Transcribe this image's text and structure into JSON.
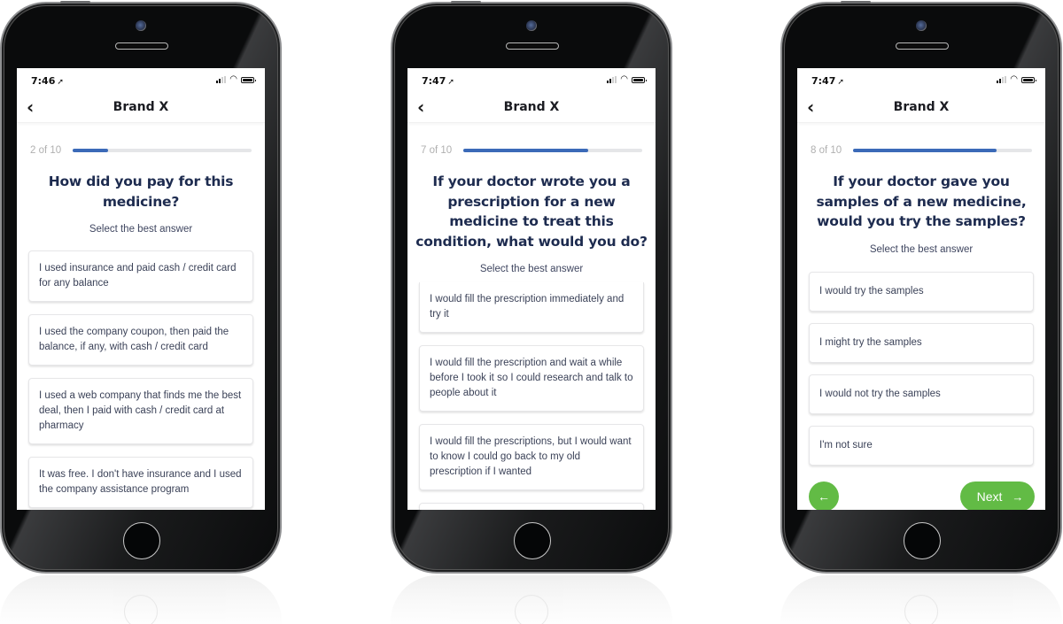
{
  "theme": {
    "accent": "#3b6ab8",
    "track": "#e5e6e8",
    "question_color": "#1d2b4f",
    "button_green": "#62bb45"
  },
  "phones": [
    {
      "status": {
        "time": "7:46",
        "location_icon": "location-arrow-icon"
      },
      "nav": {
        "back_icon": "chevron-left-icon",
        "title": "Brand X"
      },
      "progress": {
        "label": "2 of 10",
        "current": 2,
        "total": 10,
        "fraction": 0.2
      },
      "question": "How did you pay for this medicine?",
      "instruction": "Select the best answer",
      "options": [
        "I used insurance and paid cash / credit card for any balance",
        "I used the company coupon, then paid the balance, if any, with cash / credit card",
        "I used a web company that finds me the best deal, then I paid with cash / credit card at pharmacy",
        "It was free.  I don't have insurance and I used the company assistance program"
      ]
    },
    {
      "status": {
        "time": "7:47",
        "location_icon": "location-arrow-icon"
      },
      "nav": {
        "back_icon": "chevron-left-icon",
        "title": "Brand X"
      },
      "progress": {
        "label": "7 of 10",
        "current": 7,
        "total": 10,
        "fraction": 0.7
      },
      "question": "If your doctor wrote you a prescription for a new medicine to treat this condition, what would you do?",
      "instruction": "Select the best answer",
      "options": [
        "I would fill the prescription immediately and try it",
        "I would fill the prescription and wait a while before I took it so I could research and talk to people about it",
        "I would fill the prescriptions, but I would want to know I could go back to my old prescription if I wanted"
      ]
    },
    {
      "status": {
        "time": "7:47",
        "location_icon": "location-arrow-icon"
      },
      "nav": {
        "back_icon": "chevron-left-icon",
        "title": "Brand X"
      },
      "progress": {
        "label": "8 of 10",
        "current": 8,
        "total": 10,
        "fraction": 0.8
      },
      "question": "If your doctor gave you samples of a new medicine, would you try the samples?",
      "instruction": "Select the best answer",
      "options": [
        "I would try the samples",
        "I might try the samples",
        "I would not try the samples",
        "I'm not sure"
      ],
      "footer": {
        "prev_icon": "arrow-left-icon",
        "next_label": "Next",
        "next_icon": "arrow-right-icon"
      }
    }
  ]
}
